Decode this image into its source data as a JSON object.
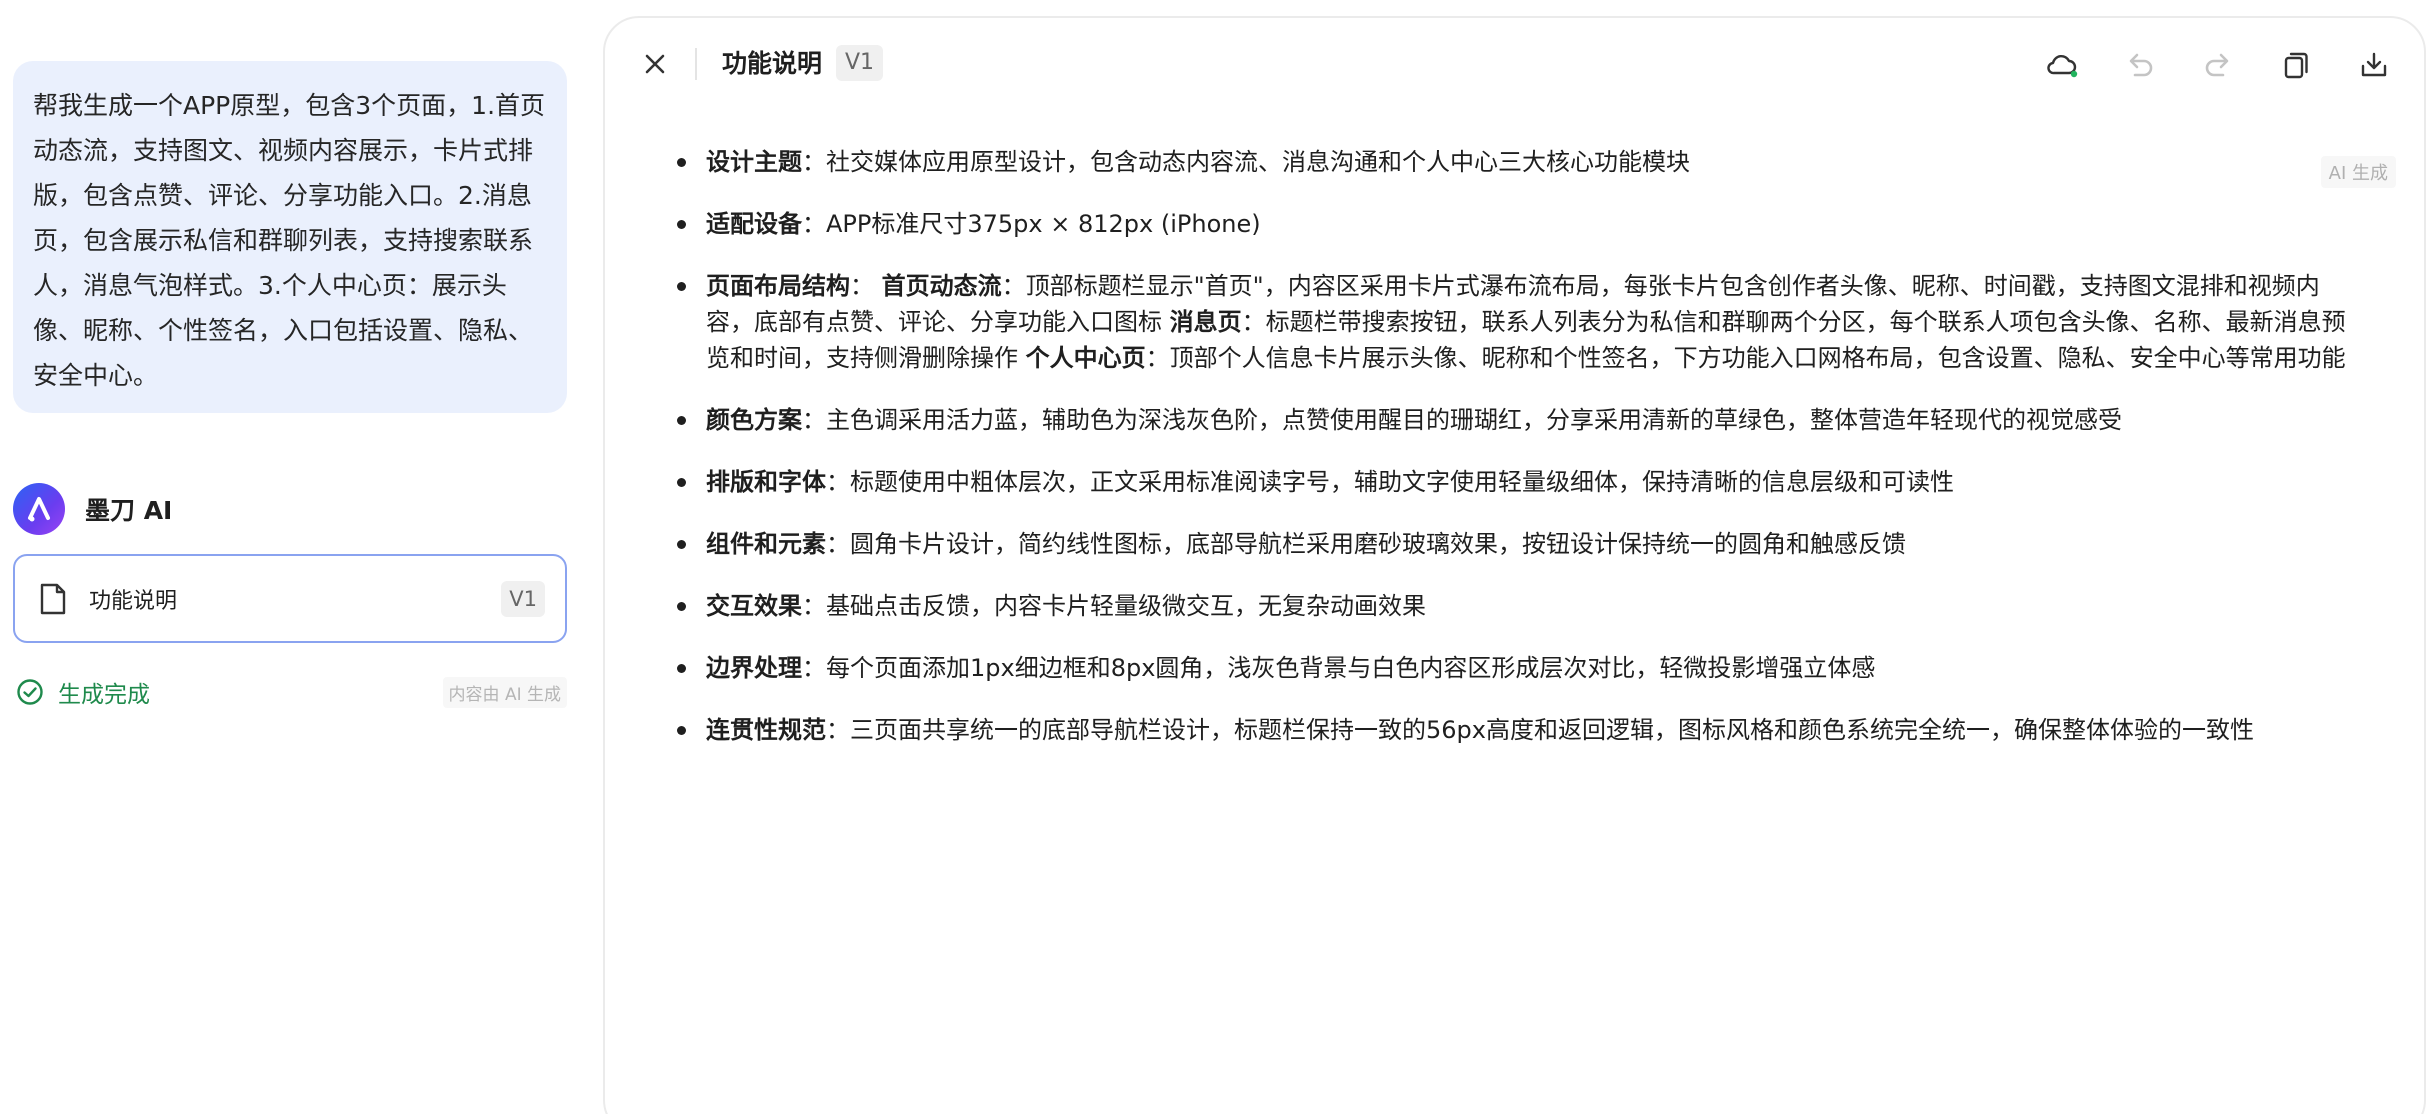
{
  "prompt": {
    "text": "帮我生成一个APP原型，包含3个页面，1.首页动态流，支持图文、视频内容展示，卡片式排版，包含点赞、评论、分享功能入口。2.消息页，包含展示私信和群聊列表，支持搜索联系人，消息气泡样式。3.个人中心页：展示头像、昵称、个性签名，入口包括设置、隐私、安全中心。"
  },
  "assistant": {
    "name": "墨刀 AI",
    "card_title": "功能说明",
    "card_version": "V1",
    "status": "生成完成",
    "note": "内容由 AI 生成"
  },
  "document": {
    "title": "功能说明",
    "version": "V1",
    "ai_tag": "AI 生成",
    "toolbar": [
      "cloud-sync-icon",
      "undo-icon",
      "redo-icon",
      "copy-icon",
      "download-icon"
    ],
    "items": [
      {
        "label": "设计主题",
        "text": "：社交媒体应用原型设计，包含动态内容流、消息沟通和个人中心三大核心功能模块"
      },
      {
        "label": "适配设备",
        "text": "：APP标准尺寸375px × 812px (iPhone)"
      },
      {
        "label": "页面布局结构",
        "text": "：",
        "sub1_label": "首页动态流",
        "sub1_text": "：顶部标题栏显示\"首页\"，内容区采用卡片式瀑布流布局，每张卡片包含创作者头像、昵称、时间戳，支持图文混排和视频内容，底部有点赞、评论、分享功能入口图标",
        "sub2_label": "消息页",
        "sub2_text": "：标题栏带搜索按钮，联系人列表分为私信和群聊两个分区，每个联系人项包含头像、名称、最新消息预览和时间，支持侧滑删除操作",
        "sub3_label": "个人中心页",
        "sub3_text": "：顶部个人信息卡片展示头像、昵称和个性签名，下方功能入口网格布局，包含设置、隐私、安全中心等常用功能"
      },
      {
        "label": "颜色方案",
        "text": "：主色调采用活力蓝，辅助色为深浅灰色阶，点赞使用醒目的珊瑚红，分享采用清新的草绿色，整体营造年轻现代的视觉感受"
      },
      {
        "label": "排版和字体",
        "text": "：标题使用中粗体层次，正文采用标准阅读字号，辅助文字使用轻量级细体，保持清晰的信息层级和可读性"
      },
      {
        "label": "组件和元素",
        "text": "：圆角卡片设计，简约线性图标，底部导航栏采用磨砂玻璃效果，按钮设计保持统一的圆角和触感反馈"
      },
      {
        "label": "交互效果",
        "text": "：基础点击反馈，内容卡片轻量级微交互，无复杂动画效果"
      },
      {
        "label": "边界处理",
        "text": "：每个页面添加1px细边框和8px圆角，浅灰色背景与白色内容区形成层次对比，轻微投影增强立体感"
      },
      {
        "label": "连贯性规范",
        "text": "：三页面共享统一的底部导航栏设计，标题栏保持一致的56px高度和返回逻辑，图标风格和颜色系统完全统一，确保整体体验的一致性"
      }
    ]
  },
  "colors": {
    "bubble": "#eaf0fd",
    "accent_border": "#8aa3f0",
    "success": "#1f8a4c",
    "cloud_dot": "#22b35e"
  }
}
